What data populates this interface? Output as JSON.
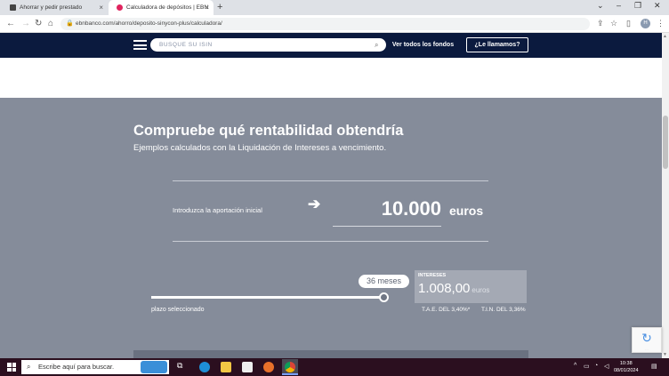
{
  "browser": {
    "tabs": [
      {
        "title": "Ahorrar y pedir prestado"
      },
      {
        "title": "Calculadora de depósitos | EBN"
      }
    ],
    "url": "ebnbanco.com/ahorro/deposito-sinycon-plus/calculadora/",
    "profile_initial": "H"
  },
  "site": {
    "search_placeholder": "BUSQUE SU ISIN",
    "btn_funds": "Ver todos los fondos",
    "btn_call": "¿Le llamamos?"
  },
  "calc": {
    "title": "Compruebe qué rentabilidad obtendría",
    "subtitle": "Ejemplos calculados con la Liquidación de Intereses a vencimiento.",
    "input_label": "Introduzca la aportación inicial",
    "amount": "10.000",
    "currency": "euros",
    "term_bubble": "36 meses",
    "term_label": "plazo seleccionado",
    "slider_fraction": 1.0,
    "interest_label": "INTERESES",
    "interest_value": "1.008,00",
    "interest_unit": "euros",
    "tae": "T.A.E. DEL 3,40%*",
    "tin": "T.I.N. DEL 3,36%"
  },
  "taskbar": {
    "search_placeholder": "Escribe aquí para buscar.",
    "time": "10:38",
    "date": "08/01/2024"
  },
  "colors": {
    "header": "#0b1a3e",
    "panel": "#858c9a",
    "taskbar": "#2b0f1f"
  }
}
